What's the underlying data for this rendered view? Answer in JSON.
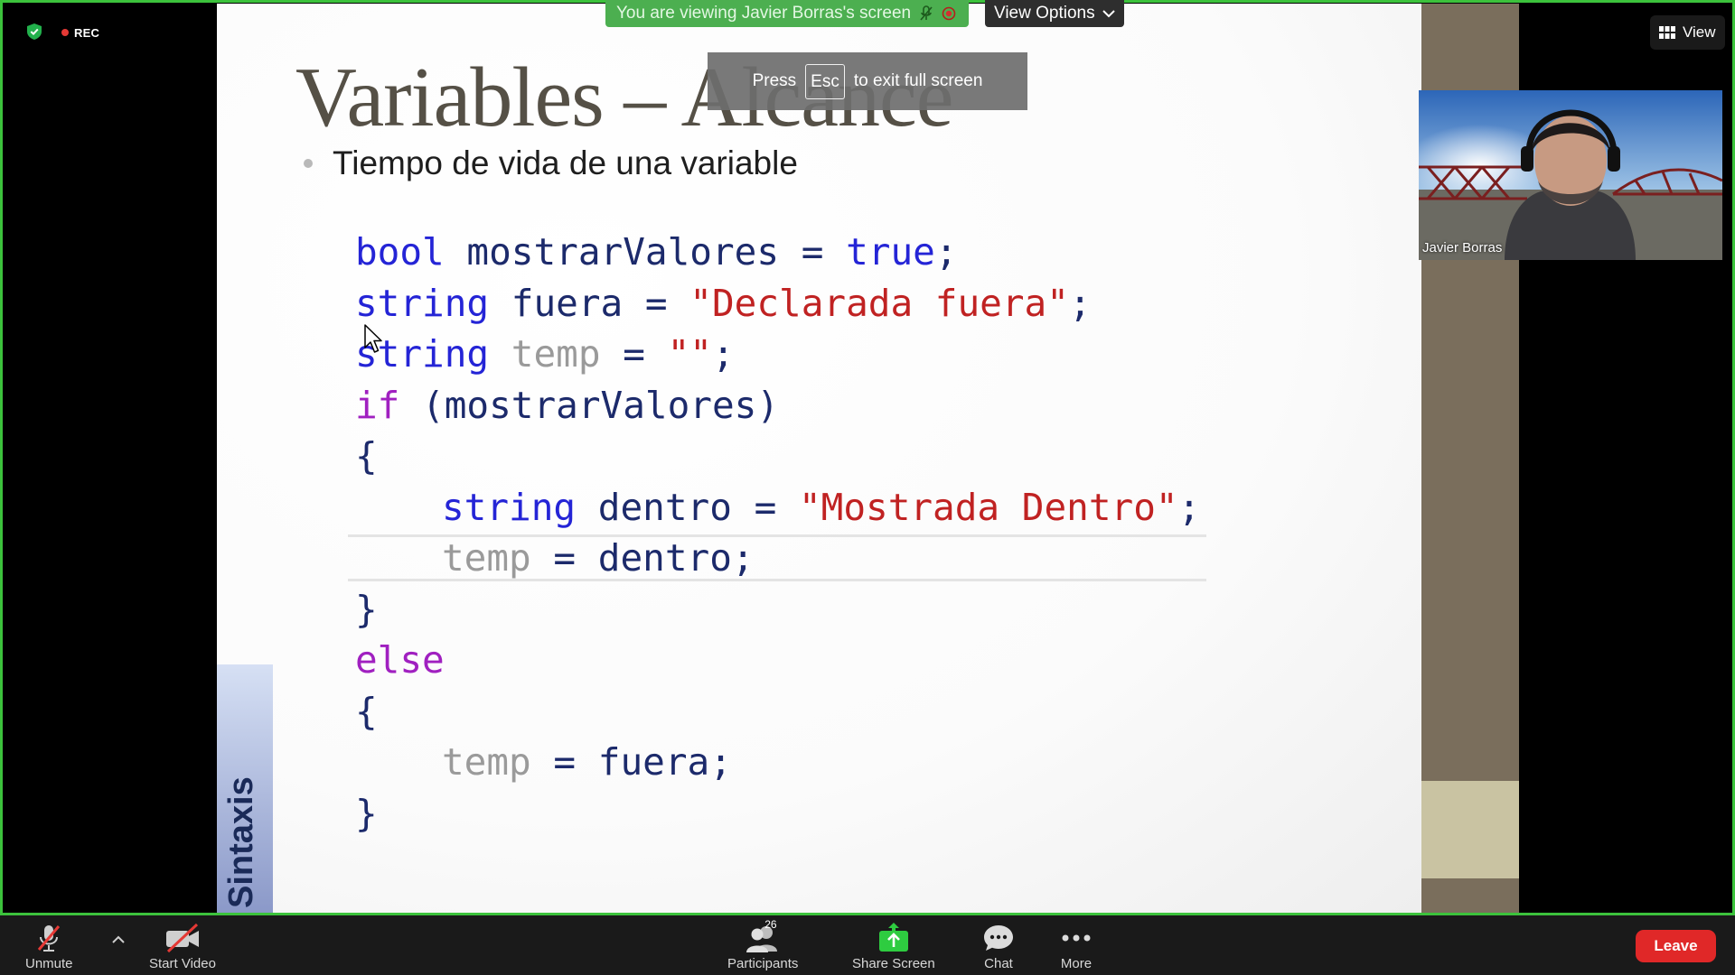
{
  "meeting": {
    "recording_label": "REC",
    "banner_text": "You are viewing Javier Borras's screen",
    "view_options_label": "View Options",
    "view_label": "View",
    "fullscreen_hint": {
      "before": "Press",
      "key": "Esc",
      "after": "to exit full screen"
    }
  },
  "slide": {
    "title": "Variables – Alcance",
    "bullet": "Tiempo de vida de una variable",
    "side_label": "Sintaxis",
    "code": [
      {
        "parts": [
          {
            "t": "bool",
            "c": "kw"
          },
          {
            "t": " mostrarValores = ",
            "c": ""
          },
          {
            "t": "true",
            "c": "kw"
          },
          {
            "t": ";",
            "c": ""
          }
        ]
      },
      {
        "parts": [
          {
            "t": "string",
            "c": "kw"
          },
          {
            "t": " fuera = ",
            "c": ""
          },
          {
            "t": "\"Declarada fuera\"",
            "c": "str"
          },
          {
            "t": ";",
            "c": ""
          }
        ]
      },
      {
        "parts": [
          {
            "t": "string",
            "c": "kw"
          },
          {
            "t": " ",
            "c": ""
          },
          {
            "t": "temp",
            "c": "dim"
          },
          {
            "t": " = ",
            "c": ""
          },
          {
            "t": "\"\"",
            "c": "str"
          },
          {
            "t": ";",
            "c": ""
          }
        ]
      },
      {
        "parts": [
          {
            "t": "if",
            "c": "kwp"
          },
          {
            "t": " (mostrarValores)",
            "c": ""
          }
        ]
      },
      {
        "parts": [
          {
            "t": "{",
            "c": ""
          }
        ]
      },
      {
        "indent": true,
        "parts": [
          {
            "t": "string",
            "c": "kw"
          },
          {
            "t": " dentro = ",
            "c": ""
          },
          {
            "t": "\"Mostrada Dentro\"",
            "c": "str"
          },
          {
            "t": ";",
            "c": ""
          }
        ]
      },
      {
        "indent": true,
        "parts": [
          {
            "t": "temp",
            "c": "dim"
          },
          {
            "t": " = dentro;",
            "c": ""
          }
        ]
      },
      {
        "parts": [
          {
            "t": "}",
            "c": ""
          }
        ]
      },
      {
        "parts": [
          {
            "t": "else",
            "c": "kwp"
          }
        ]
      },
      {
        "parts": [
          {
            "t": "{",
            "c": ""
          }
        ]
      },
      {
        "indent": true,
        "parts": [
          {
            "t": "temp",
            "c": "dim"
          },
          {
            "t": " = fuera;",
            "c": ""
          }
        ]
      },
      {
        "parts": [
          {
            "t": "}",
            "c": ""
          }
        ]
      }
    ]
  },
  "participant_video": {
    "name": "Javier Borras"
  },
  "toolbar": {
    "unmute": "Unmute",
    "start_video": "Start Video",
    "participants": "Participants",
    "participants_count": "26",
    "share_screen": "Share Screen",
    "chat": "Chat",
    "more": "More",
    "leave": "Leave"
  },
  "colors": {
    "share_green": "#3cc23c",
    "leave_red": "#e02828",
    "share_icon": "#2ecc40"
  }
}
